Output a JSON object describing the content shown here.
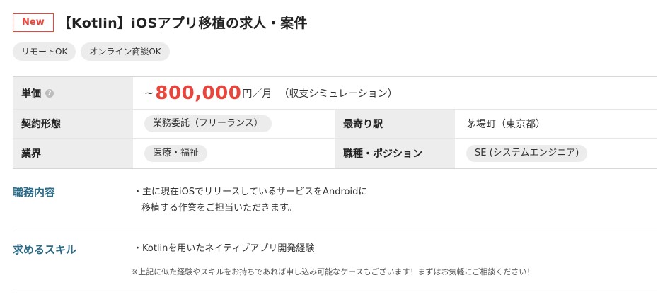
{
  "header": {
    "badge": "New",
    "title": "【Kotlin】iOSアプリ移植の求人・案件"
  },
  "tags": [
    "リモートOK",
    "オンライン商談OK"
  ],
  "info": {
    "price_label": "単価",
    "help_glyph": "?",
    "price_prefix": "~",
    "price_value": "800,000",
    "price_unit": "円／月",
    "sim_open": "（",
    "sim_link": "収支シミュレーション",
    "sim_close": "）",
    "contract_label": "契約形態",
    "contract_value": "業務委託（フリーランス）",
    "station_label": "最寄り駅",
    "station_value": "茅場町（東京都）",
    "industry_label": "業界",
    "industry_value": "医療・福祉",
    "position_label": "職種・ポジション",
    "position_value": "SE (システムエンジニア)"
  },
  "duties": {
    "label": "職務内容",
    "line1": "・主に現在iOSでリリースしているサービスをAndroidに",
    "line2": "移植する作業をご担当いただきます。"
  },
  "skills": {
    "label": "求めるスキル",
    "line1": "・Kotlinを用いたネイティブアプリ開発経験",
    "note": "※上記に似た経験やスキルをお持ちであれば申し込み可能なケースもございます！まずはお気軽にご相談ください！"
  }
}
